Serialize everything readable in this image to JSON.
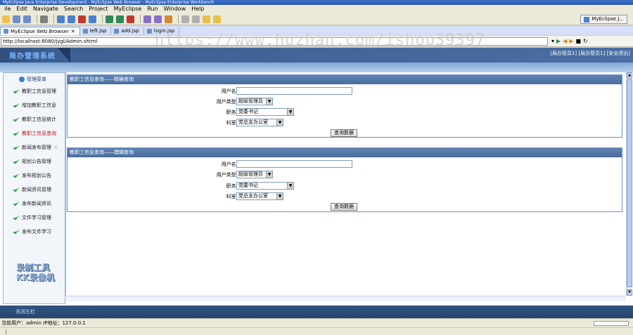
{
  "window": {
    "title": "MyEclipse Java Enterprise Development - MyEclipse Web Browser - MyEclipse Enterprise Workbench"
  },
  "menu": [
    "ile",
    "Edit",
    "Navigate",
    "Search",
    "Project",
    "MyEclipse",
    "Run",
    "Window",
    "Help"
  ],
  "perspective": {
    "label": "MyEclipse J..."
  },
  "tabs": [
    {
      "label": "MyEclipse Web Browser",
      "active": true
    },
    {
      "label": "left.jsp",
      "active": false
    },
    {
      "label": "add.jsp",
      "active": false
    },
    {
      "label": "login.jsp",
      "active": false
    }
  ],
  "address": {
    "url": "http://localhost:8080/jygl/Admin.shtml"
  },
  "watermark": "https://www.huzhan.com/ishop39397",
  "app": {
    "logo": "局办管理系统",
    "userinfo": "[局办管员1] [局办管员1] [安全退出]"
  },
  "sidebar": {
    "title": "管理菜单",
    "items": [
      {
        "label": "教职工信息管理"
      },
      {
        "label": "增加教职工信息"
      },
      {
        "label": "教职工信息统计"
      },
      {
        "label": "教职工信息查询"
      },
      {
        "label": "新闻发布管理"
      },
      {
        "label": "规划公告管理"
      },
      {
        "label": "发布规划公告"
      },
      {
        "label": "新闻资讯管理"
      },
      {
        "label": "发布新闻资讯"
      },
      {
        "label": "文件学习管理"
      },
      {
        "label": "发布文件学习"
      }
    ],
    "selected_index": 3
  },
  "kk": {
    "line1": "录制工具",
    "line2": "KK录像机"
  },
  "panel1": {
    "title": "教职工信息查询——精确查询",
    "username_label": "用户名:",
    "usertype_label": "用户类型:",
    "usertype_value": "超级管理员",
    "position_label": "职务:",
    "position_value": "党委书记",
    "dept_label": "科室:",
    "dept_value": "党总支办公室",
    "button": "查询数据"
  },
  "panel2": {
    "title": "教职工信息查询——模糊查询",
    "username_label": "用户名:",
    "usertype_label": "用户类型:",
    "usertype_value": "超级管理员",
    "position_label": "职务:",
    "position_value": "党委书记",
    "dept_label": "科室:",
    "dept_value": "党总支办公室",
    "button": "查询数据"
  },
  "footer": {
    "close_label": "关闭左栏"
  },
  "status": {
    "text": "当前用户：admin  IP地址：127.0.0.1"
  }
}
